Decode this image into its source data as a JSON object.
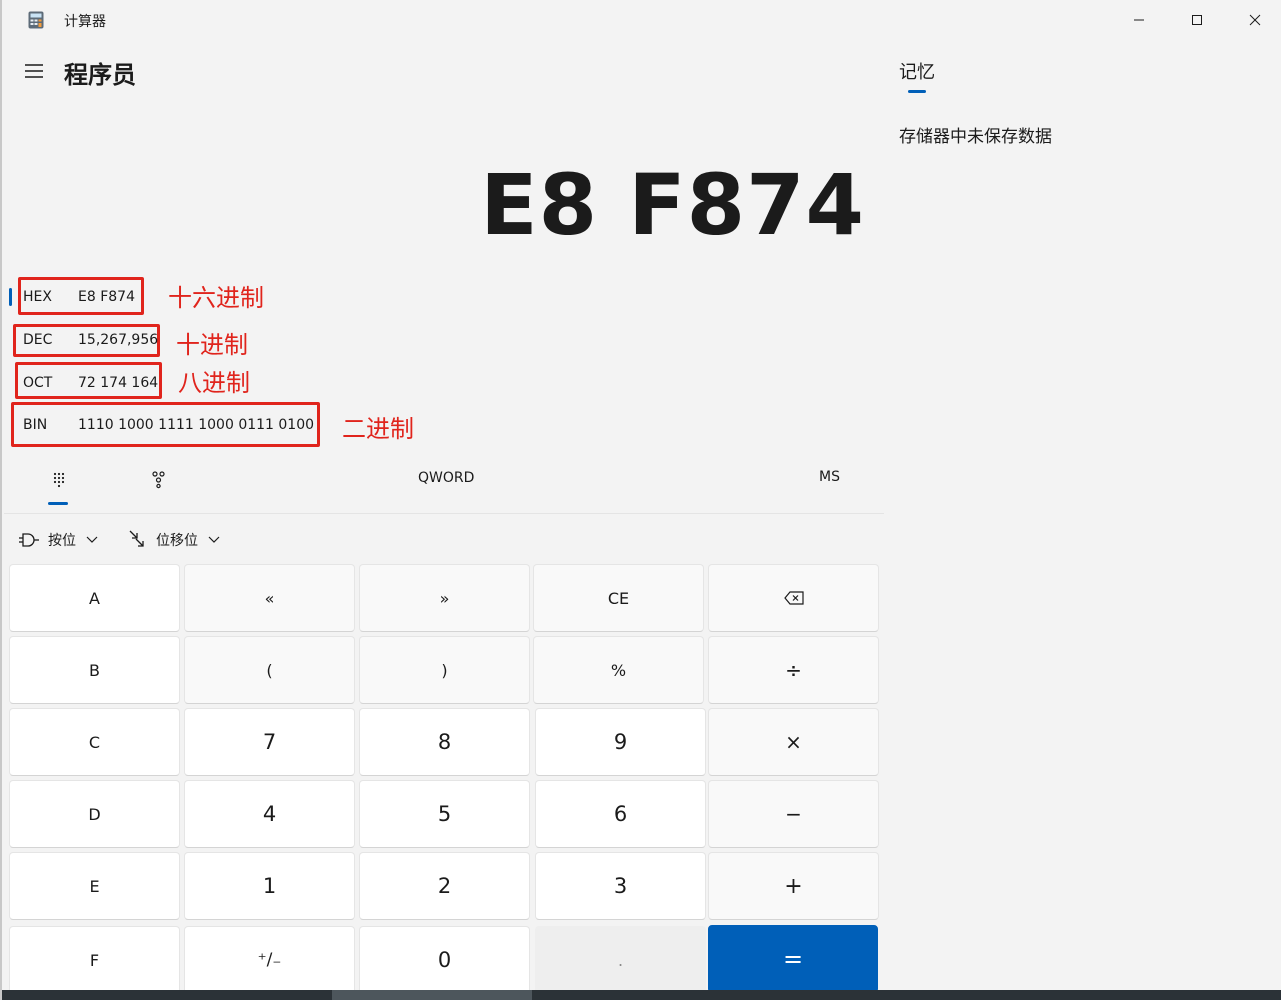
{
  "window": {
    "title": "计算器",
    "controls": {
      "minimize": "minimize-icon",
      "maximize": "maximize-icon",
      "close": "close-icon"
    }
  },
  "header": {
    "mode_title": "程序员"
  },
  "display": {
    "value": "E8 F874"
  },
  "radix": [
    {
      "label": "HEX",
      "value": "E8 F874",
      "annotation": "十六进制",
      "selected": true
    },
    {
      "label": "DEC",
      "value": "15,267,956",
      "annotation": "十进制",
      "selected": false
    },
    {
      "label": "OCT",
      "value": "72 174 164",
      "annotation": "八进制",
      "selected": false
    },
    {
      "label": "BIN",
      "value": "1110 1000 1111 1000 0111 0100",
      "annotation": "二进制",
      "selected": false
    }
  ],
  "annotation_color": "#e0241c",
  "mode_bar": {
    "word_size": "QWORD",
    "memory_store": "MS"
  },
  "toolbar": {
    "bitwise": "按位",
    "bitshift": "位移位"
  },
  "keys": [
    [
      "A",
      "«",
      "»",
      "CE",
      "⌫"
    ],
    [
      "B",
      "(",
      ")",
      "%",
      "÷"
    ],
    [
      "C",
      "7",
      "8",
      "9",
      "×"
    ],
    [
      "D",
      "4",
      "5",
      "6",
      "−"
    ],
    [
      "E",
      "1",
      "2",
      "3",
      "+"
    ],
    [
      "F",
      "⁺/₋",
      "0",
      ".",
      "="
    ]
  ],
  "memory": {
    "tab": "记忆",
    "empty_message": "存储器中未保存数据"
  },
  "accent_color": "#005fb8"
}
